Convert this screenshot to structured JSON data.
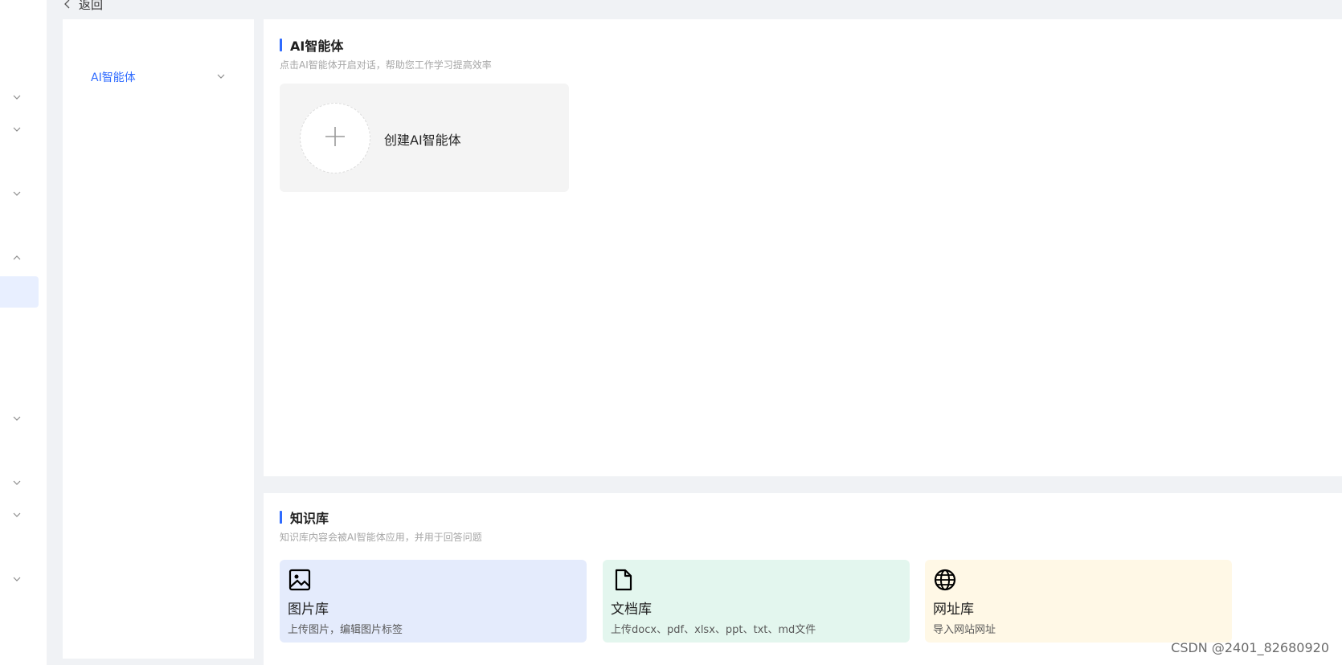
{
  "nav": {
    "back_label": "返回"
  },
  "sidebar": {
    "items": [
      {
        "label": "AI智能体",
        "icon": "chevron-down-icon"
      }
    ]
  },
  "ai_section": {
    "title": "AI智能体",
    "subtitle": "点击AI智能体开启对话，帮助您工作学习提高效率",
    "create_card_label": "创建AI智能体"
  },
  "kb_section": {
    "title": "知识库",
    "subtitle": "知识库内容会被AI智能体应用，并用于回答问题",
    "cards": [
      {
        "name": "图片库",
        "desc": "上传图片，编辑图片标签",
        "icon": "image-icon",
        "color": "#e4ebfc"
      },
      {
        "name": "文档库",
        "desc": "上传docx、pdf、xlsx、ppt、txt、md文件",
        "icon": "document-icon",
        "color": "#e3f6ee"
      },
      {
        "name": "网址库",
        "desc": "导入网站网址",
        "icon": "globe-icon",
        "color": "#fff8e6"
      }
    ]
  },
  "accent_color": "#2f6bff",
  "watermark": "CSDN @2401_82680920"
}
